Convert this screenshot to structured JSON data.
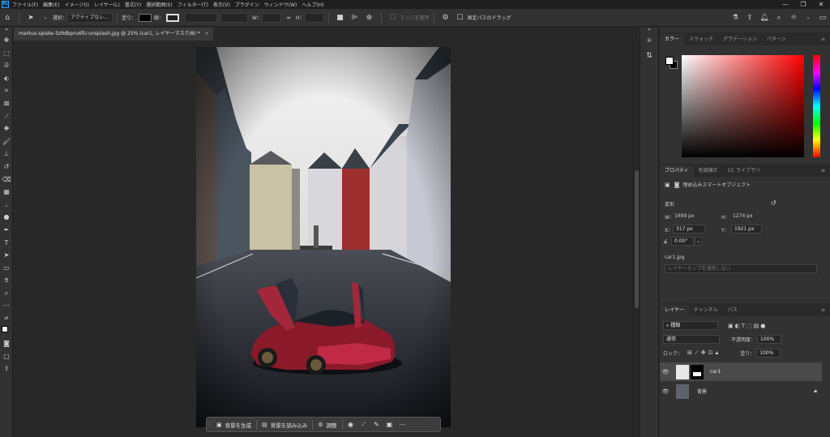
{
  "menubar": {
    "items": [
      "ファイル(F)",
      "編集(E)",
      "イメージ(I)",
      "レイヤー(L)",
      "書式(Y)",
      "選択範囲(S)",
      "フィルター(T)",
      "表示(V)",
      "プラグイン",
      "ウィンドウ(W)",
      "ヘルプ(H)"
    ],
    "logo": "Ps"
  },
  "optionsbar": {
    "select_label": "選択：",
    "select_value": "アクティブなレ…",
    "fill_label": "塗り：",
    "stroke_label": "線：",
    "w_label": "W：",
    "h_label": "H：",
    "align_edges_label": "エッジを整列",
    "constrain_path_label": "固定パスのドラッグ"
  },
  "document": {
    "tab_title": "markus-spiske-5z9dbpru6fU-unsplash.jpg @ 25% (car1, レイヤーマスク/8) *",
    "close": "×"
  },
  "contextbar": {
    "generate_bg": "背景を生成",
    "import_bg": "背景を読み込み",
    "adjust": "調整",
    "more": "⋯"
  },
  "color_panel": {
    "tabs": [
      "カラー",
      "スウォッチ",
      "グラデーション",
      "パターン"
    ],
    "accent_hue": "#ff0000"
  },
  "properties_panel": {
    "tabs": [
      "プロパティ",
      "色調補正",
      "CC ライブラリ"
    ],
    "type_label": "埋め込みスマートオブジェクト",
    "transform_label": "変形",
    "w_label": "W：",
    "w_value": "1699 px",
    "h_label": "H：",
    "h_value": "1274 px",
    "x_label": "X：",
    "x_value": "317 px",
    "y_label": "Y：",
    "y_value": "1921 px",
    "angle_value": "0.00°",
    "file_name": "car1.jpg",
    "comp_placeholder": "レイヤーカンプを適用しない"
  },
  "layers_panel": {
    "tabs": [
      "レイヤー",
      "チャンネル",
      "パス"
    ],
    "filter_kind": "種類",
    "blend_mode": "通常",
    "opacity_label": "不透明度：",
    "opacity_value": "100%",
    "lock_label": "ロック：",
    "fill_label": "塗り：",
    "fill_value": "100%",
    "layers": [
      {
        "name": "car1"
      },
      {
        "name": "背景"
      }
    ]
  }
}
